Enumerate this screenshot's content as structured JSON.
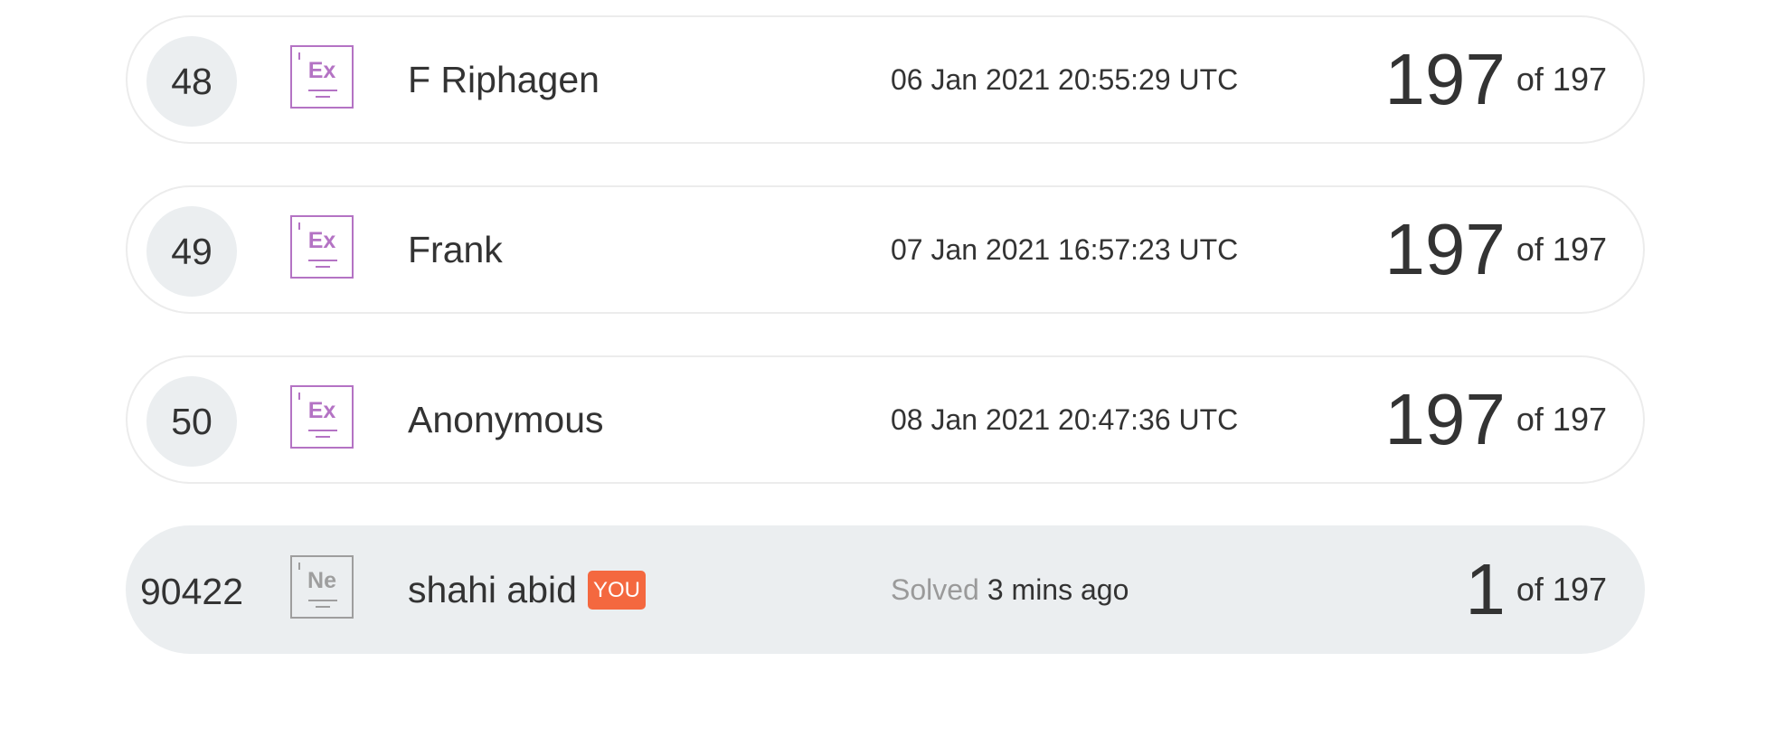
{
  "leaderboard": {
    "rows": [
      {
        "rank": "48",
        "level": "Ex",
        "name": "F Riphagen",
        "date": "06 Jan 2021 20:55:29 UTC",
        "score": "197",
        "of": "of 197"
      },
      {
        "rank": "49",
        "level": "Ex",
        "name": "Frank",
        "date": "07 Jan 2021 16:57:23 UTC",
        "score": "197",
        "of": "of 197"
      },
      {
        "rank": "50",
        "level": "Ex",
        "name": "Anonymous",
        "date": "08 Jan 2021 20:47:36 UTC",
        "score": "197",
        "of": "of 197"
      }
    ],
    "current_user": {
      "rank": "90422",
      "level": "Ne",
      "name": "shahi abid",
      "badge": "YOU",
      "solved_label": "Solved",
      "solved_time": "3 mins ago",
      "score": "1",
      "of": "of 197"
    }
  },
  "colors": {
    "expert_level": "#b473c4",
    "novice_level": "#9e9e9e",
    "you_badge": "#f4683f",
    "highlight_row": "#ebeef0"
  },
  "icons": {
    "expert": "expert-level-icon",
    "novice": "novice-level-icon"
  }
}
